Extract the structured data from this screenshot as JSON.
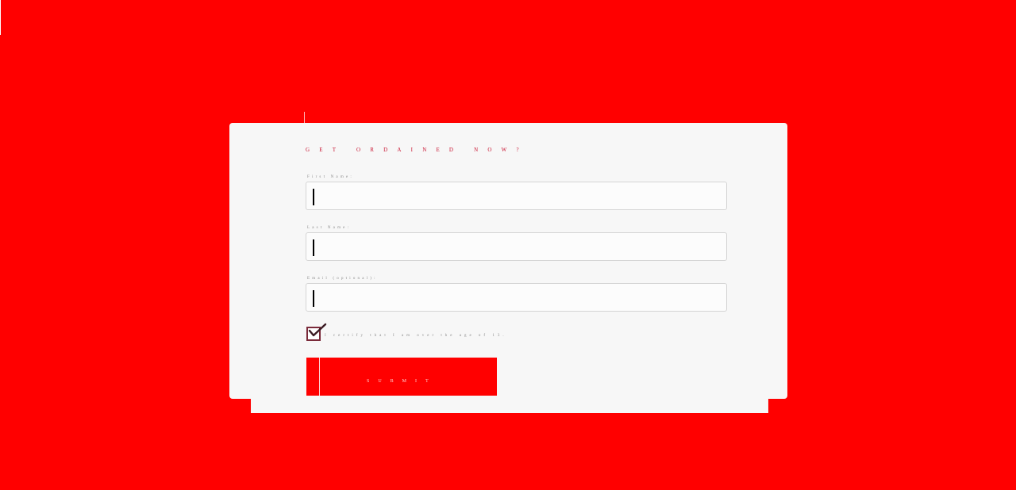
{
  "form": {
    "title": "GET ORDAINED NOW?",
    "fields": [
      {
        "label": "First Name:",
        "value": ""
      },
      {
        "label": "Last Name:",
        "value": ""
      },
      {
        "label": "Email (optional):",
        "value": ""
      }
    ],
    "checkbox": {
      "label": "I certify that I am over the age of 13.",
      "checked": true
    },
    "submit_label": "SUBMIT"
  },
  "colors": {
    "background": "#ff0000",
    "card": "#f7f7f7",
    "title": "#c8102e",
    "submit": "#ff0000"
  }
}
